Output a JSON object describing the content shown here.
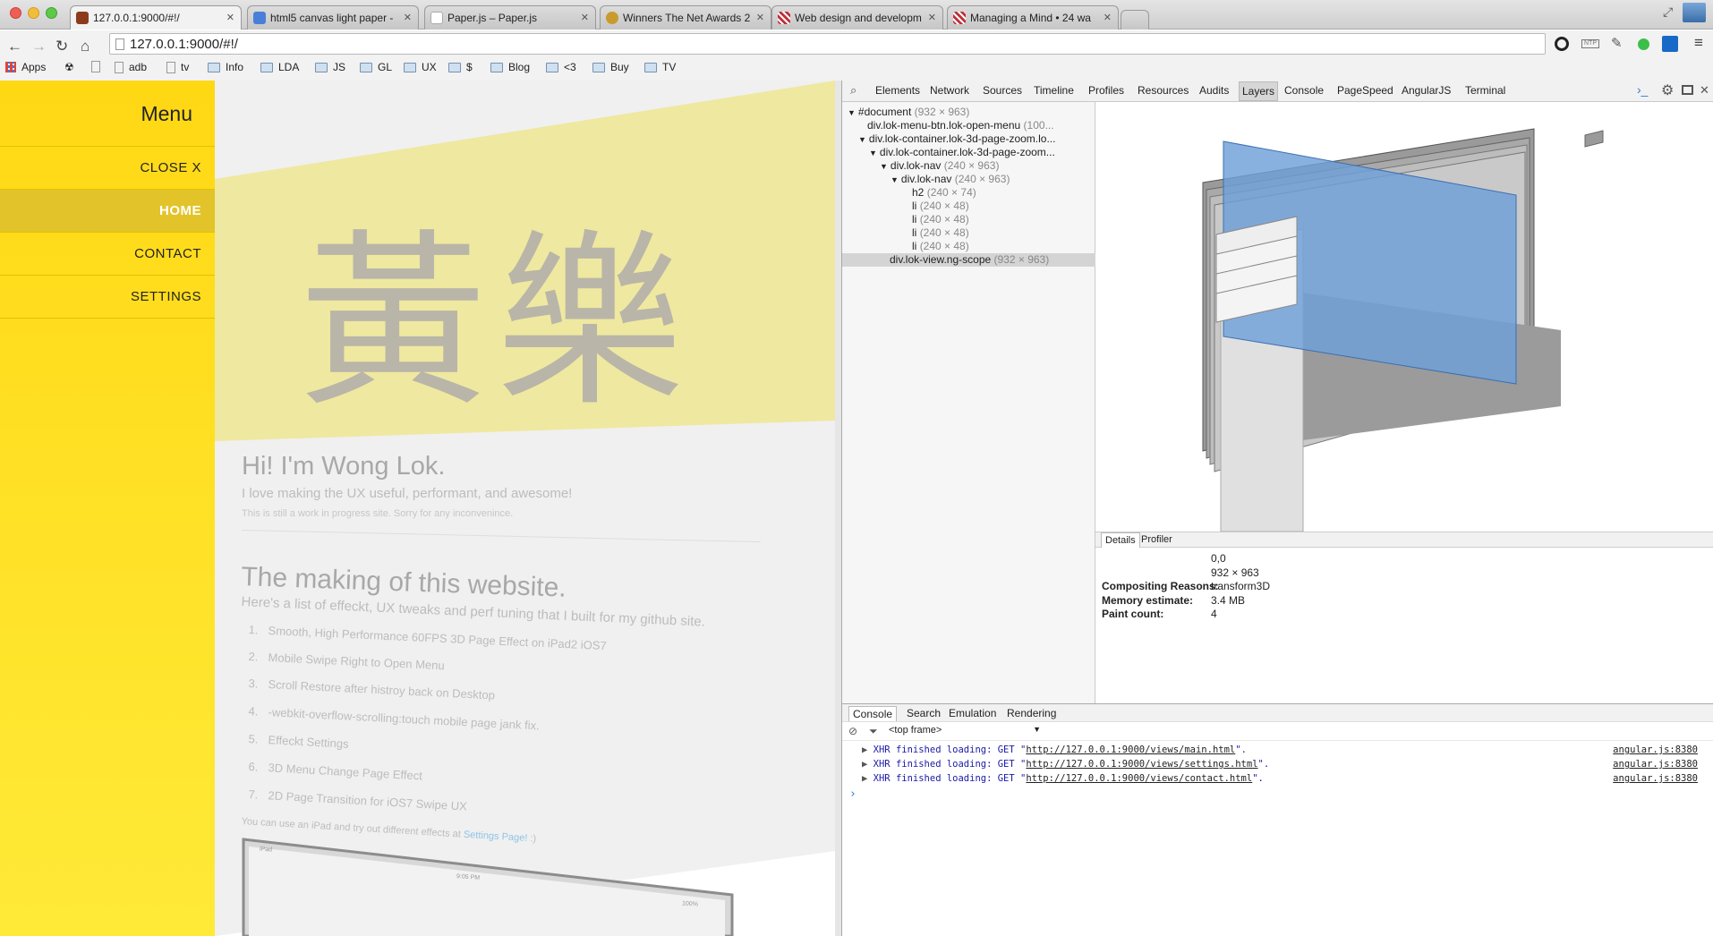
{
  "browser": {
    "tabs": [
      {
        "title": "127.0.0.1:9000/#!/",
        "active": true
      },
      {
        "title": "html5 canvas light paper -",
        "active": false
      },
      {
        "title": "Paper.js – Paper.js",
        "active": false
      },
      {
        "title": "Winners The Net Awards 2",
        "active": false
      },
      {
        "title": "Web design and developm",
        "active": false
      },
      {
        "title": "Managing a Mind • 24 wa",
        "active": false
      }
    ],
    "address": "127.0.0.1:9000/#!/",
    "bookmarks": [
      "Apps",
      "adb",
      "tv",
      "Info",
      "LDA",
      "JS",
      "GL",
      "UX",
      "$",
      "Blog",
      "<3",
      "Buy",
      "TV"
    ]
  },
  "menu": {
    "title": "Menu",
    "items": [
      "CLOSE X",
      "HOME",
      "CONTACT",
      "SETTINGS"
    ],
    "active_index": 1
  },
  "page": {
    "hero_chars": "黃樂",
    "greeting": "Hi! I'm Wong Lok.",
    "tagline": "I love making the UX useful, performant, and awesome!",
    "notice": "This is still a work in progress site. Sorry for any inconvenince.",
    "making_title": "The making of this website.",
    "making_intro": "Here's a list of effeckt, UX tweaks and perf tuning that I built for my github site.",
    "list": [
      "Smooth, High Performance 60FPS 3D Page Effect on iPad2 iOS7",
      "Mobile Swipe Right to Open Menu",
      "Scroll Restore after histroy back on Desktop",
      "-webkit-overflow-scrolling:touch mobile page jank fix.",
      "Effeckt Settings",
      "3D Menu Change Page Effect",
      "2D Page Transition for iOS7 Swipe UX"
    ],
    "ipad_note_prefix": "You can use an iPad and try out different effects at",
    "ipad_note_link": "Settings Page!",
    "ipad_note_suffix": ":)",
    "device_status_time": "9:05 PM",
    "device_carrier": "iPad",
    "device_battery": "100%"
  },
  "devtools": {
    "tabs": [
      "Elements",
      "Network",
      "Sources",
      "Timeline",
      "Profiles",
      "Resources",
      "Audits",
      "Layers",
      "Console",
      "PageSpeed",
      "AngularJS",
      "Terminal"
    ],
    "active_tab": "Layers",
    "tree": [
      {
        "arrow": "▼",
        "name": "#document",
        "dim": "(932 × 963)"
      },
      {
        "arrow": "",
        "name": "div.lok-menu-btn.lok-open-menu",
        "dim": "(100..."
      },
      {
        "arrow": "▼",
        "name": "div.lok-container.lok-3d-page-zoom.lo...",
        "dim": ""
      },
      {
        "arrow": "▼",
        "name": "div.lok-container.lok-3d-page-zoom...",
        "dim": ""
      },
      {
        "arrow": "▼",
        "name": "div.lok-nav",
        "dim": "(240 × 963)"
      },
      {
        "arrow": "▼",
        "name": "div.lok-nav",
        "dim": "(240 × 963)"
      },
      {
        "arrow": "",
        "name": "h2",
        "dim": "(240 × 74)"
      },
      {
        "arrow": "",
        "name": "li",
        "dim": "(240 × 48)"
      },
      {
        "arrow": "",
        "name": "li",
        "dim": "(240 × 48)"
      },
      {
        "arrow": "",
        "name": "li",
        "dim": "(240 × 48)"
      },
      {
        "arrow": "",
        "name": "li",
        "dim": "(240 × 48)"
      },
      {
        "arrow": "",
        "name": "div.lok-view.ng-scope",
        "dim": "(932 × 963)"
      }
    ],
    "details_tabs": [
      "Details",
      "Profiler"
    ],
    "details": [
      {
        "label": "",
        "value": "0,0"
      },
      {
        "label": "",
        "value": "932 × 963"
      },
      {
        "label": "Compositing Reasons:",
        "value": "transform3D"
      },
      {
        "label": "Memory estimate:",
        "value": "3.4 MB"
      },
      {
        "label": "Paint count:",
        "value": "4"
      }
    ],
    "drawer_tabs": [
      "Console",
      "Search",
      "Emulation",
      "Rendering"
    ],
    "frame": "<top frame>",
    "console_lines": [
      {
        "prefix": "XHR finished loading: GET \"",
        "url": "http://127.0.0.1:9000/views/main.html",
        "suffix": "\".",
        "source": "angular.js:8380"
      },
      {
        "prefix": "XHR finished loading: GET \"",
        "url": "http://127.0.0.1:9000/views/settings.html",
        "suffix": "\".",
        "source": "angular.js:8380"
      },
      {
        "prefix": "XHR finished loading: GET \"",
        "url": "http://127.0.0.1:9000/views/contact.html",
        "suffix": "\".",
        "source": "angular.js:8380"
      }
    ],
    "prompt": "›"
  },
  "colors": {
    "menu_yellow": "#ffde1a",
    "menu_active": "#e2c42a",
    "layer_blue": "#6fa0d9"
  }
}
